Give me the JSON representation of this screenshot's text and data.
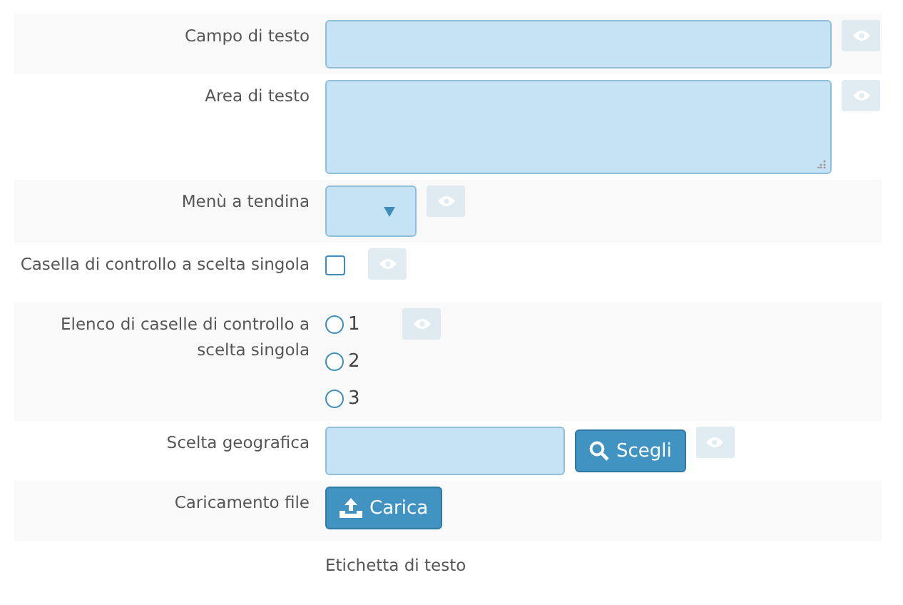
{
  "form": {
    "rows": [
      {
        "kind": "text",
        "label": "Campo di testo",
        "eye_button": true
      },
      {
        "kind": "textarea",
        "label": "Area di testo",
        "eye_button": true
      },
      {
        "kind": "select",
        "label": "Menù a tendina",
        "eye_button": true
      },
      {
        "kind": "checkbox",
        "label": "Casella di controllo a scelta singola",
        "checked": false,
        "eye_button": true
      },
      {
        "kind": "radio",
        "label": "Elenco di caselle di controllo a scelta singola",
        "eye_button": true,
        "options": [
          {
            "label": "1",
            "selected": false
          },
          {
            "label": "2",
            "selected": false
          },
          {
            "label": "3",
            "selected": false
          }
        ]
      },
      {
        "kind": "geo",
        "label": "Scelta geografica",
        "button": "Scegli",
        "eye_button": true
      },
      {
        "kind": "file",
        "label": "Caricamento file",
        "button": "Carica",
        "eye_button": false
      },
      {
        "kind": "static",
        "label": "",
        "value": "Etichetta di testo",
        "eye_button": false
      }
    ]
  }
}
